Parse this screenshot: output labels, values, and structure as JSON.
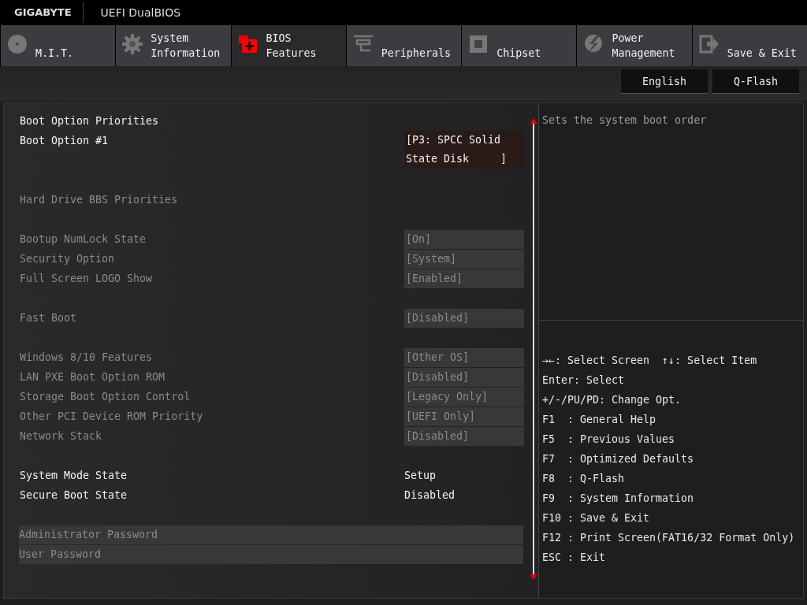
{
  "header": {
    "brand": "GIGABYTE",
    "product": "UEFI DualBIOS"
  },
  "tabs": [
    {
      "kind": "disc",
      "lines": [
        "M.I.T."
      ],
      "selected": false
    },
    {
      "kind": "gear",
      "lines": [
        "System",
        "Information"
      ],
      "selected": false
    },
    {
      "kind": "bios",
      "lines": [
        "BIOS",
        "Features"
      ],
      "selected": true
    },
    {
      "kind": "plug",
      "lines": [
        "Peripherals"
      ],
      "selected": false
    },
    {
      "kind": "chip",
      "lines": [
        "Chipset"
      ],
      "selected": false
    },
    {
      "kind": "power",
      "lines": [
        "Power",
        "Management"
      ],
      "selected": false
    },
    {
      "kind": "exit",
      "lines": [
        "Save & Exit"
      ],
      "selected": false
    }
  ],
  "toolbar_buttons": [
    "English",
    "Q-Flash"
  ],
  "sections": [
    [
      {
        "kind": "header",
        "label": "Boot Option Priorities",
        "disabled": false
      },
      {
        "kind": "option",
        "label": "Boot Option #1",
        "value_lines": [
          "[P3: SPCC Solid",
          "State Disk     ]"
        ],
        "disabled": false,
        "selected": true
      }
    ],
    [
      {
        "kind": "link",
        "label": "Hard Drive BBS Priorities",
        "disabled": true
      }
    ],
    [
      {
        "kind": "option",
        "label": "Bootup NumLock State",
        "value_lines": [
          "[On]"
        ],
        "disabled": true,
        "selected": false
      },
      {
        "kind": "option",
        "label": "Security Option",
        "value_lines": [
          "[System]"
        ],
        "disabled": true,
        "selected": false
      },
      {
        "kind": "option",
        "label": "Full Screen LOGO Show",
        "value_lines": [
          "[Enabled]"
        ],
        "disabled": true,
        "selected": false
      }
    ],
    [
      {
        "kind": "option",
        "label": "Fast Boot",
        "value_lines": [
          "[Disabled]"
        ],
        "disabled": true,
        "selected": false
      }
    ],
    [
      {
        "kind": "option",
        "label": "Windows 8/10 Features",
        "value_lines": [
          "[Other OS]"
        ],
        "disabled": true,
        "selected": false
      },
      {
        "kind": "option",
        "label": "LAN PXE Boot Option ROM",
        "value_lines": [
          "[Disabled]"
        ],
        "disabled": true,
        "selected": false
      },
      {
        "kind": "option",
        "label": "Storage Boot Option Control",
        "value_lines": [
          "[Legacy Only]"
        ],
        "disabled": true,
        "selected": false
      },
      {
        "kind": "option",
        "label": "Other PCI Device ROM Priority",
        "value_lines": [
          "[UEFI Only]"
        ],
        "disabled": true,
        "selected": false
      },
      {
        "kind": "option",
        "label": "Network Stack",
        "value_lines": [
          "[Disabled]"
        ],
        "disabled": true,
        "selected": false
      }
    ],
    [
      {
        "kind": "info",
        "label": "System Mode State",
        "value": "Setup",
        "disabled": false
      },
      {
        "kind": "info",
        "label": "Secure Boot State",
        "value": "Disabled",
        "disabled": false
      }
    ],
    [
      {
        "kind": "password",
        "label": "Administrator Password",
        "disabled": true
      },
      {
        "kind": "password",
        "label": "User Password",
        "disabled": true
      }
    ]
  ],
  "help_text": "Sets the system boot order",
  "key_help": [
    "→←: Select Screen  ↑↓: Select Item",
    "Enter: Select",
    "+/-/PU/PD: Change Opt.",
    "F1  : General Help",
    "F5  : Previous Values",
    "F7  : Optimized Defaults",
    "F8  : Q-Flash",
    "F9  : System Information",
    "F10 : Save & Exit",
    "F12 : Print Screen(FAT16/32 Format Only)",
    "ESC : Exit"
  ]
}
